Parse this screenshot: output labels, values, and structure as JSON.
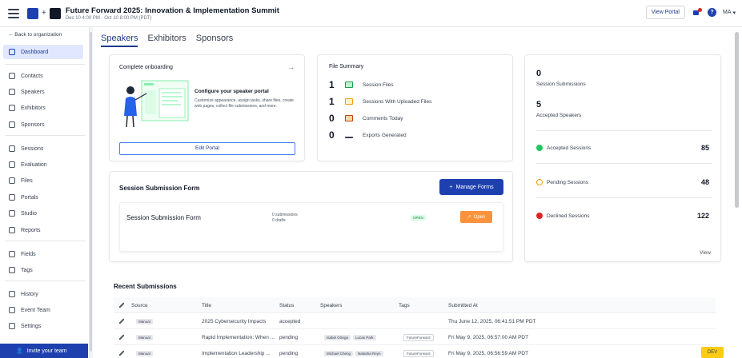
{
  "header": {
    "event_title": "Future Forward 2025: Innovation & Implementation Summit",
    "event_dates": "Dec 10 4:00 PM - Oct 10 8:00 PM (PDT)",
    "view_portal": "View Portal",
    "avatar_initials": "MA"
  },
  "sidebar": {
    "back_label": "← Back to organization",
    "items": [
      {
        "label": "Dashboard"
      },
      {
        "label": "Contacts"
      },
      {
        "label": "Speakers"
      },
      {
        "label": "Exhibitors"
      },
      {
        "label": "Sponsors"
      },
      {
        "label": "Sessions"
      },
      {
        "label": "Evaluation"
      },
      {
        "label": "Files"
      },
      {
        "label": "Portals"
      },
      {
        "label": "Studio"
      },
      {
        "label": "Reports"
      },
      {
        "label": "Fields"
      },
      {
        "label": "Tags"
      },
      {
        "label": "History"
      },
      {
        "label": "Event Team"
      },
      {
        "label": "Settings"
      }
    ],
    "invite_label": "Invite your team"
  },
  "tabs": [
    {
      "label": "Speakers"
    },
    {
      "label": "Exhibitors"
    },
    {
      "label": "Sponsors"
    }
  ],
  "onboarding": {
    "title": "Complete onboarding",
    "heading": "Configure your speaker portal",
    "description": "Customize appearance, assign tasks, share files, create web pages, collect file submissions, and more.",
    "button": "Edit Portal"
  },
  "file_summary": {
    "title": "File Summary",
    "rows": [
      {
        "value": "1",
        "label": "Session Files",
        "color": "#16a34a"
      },
      {
        "value": "1",
        "label": "Sessions With Uploaded Files",
        "color": "#f59e0b"
      },
      {
        "value": "0",
        "label": "Comments Today",
        "color": "#c2410c"
      },
      {
        "value": "0",
        "label": "Exports Generated",
        "color": "#374151"
      }
    ]
  },
  "stats": {
    "session_submissions_value": "0",
    "session_submissions_label": "Session Submissions",
    "accepted_speakers_value": "5",
    "accepted_speakers_label": "Accepted Speakers",
    "rows": [
      {
        "label": "Accepted Sessions",
        "value": "85",
        "color": "#22c55e"
      },
      {
        "label": "Pending Sessions",
        "value": "48",
        "color": "#f59e0b"
      },
      {
        "label": "Declined Sessions",
        "value": "122",
        "color": "#dc2626"
      }
    ],
    "view": "View"
  },
  "submission_form": {
    "title": "Session Submission Form",
    "manage_button": "Manage Forms",
    "form_name": "Session Submission Form",
    "submissions": "0 submissions",
    "drafts": "0 drafts",
    "status": "OPEN",
    "open_button": "Open"
  },
  "recent": {
    "title": "Recent Submissions",
    "columns": [
      "Source",
      "Title",
      "Status",
      "Speakers",
      "Tags",
      "Submitted At"
    ],
    "rows": [
      {
        "source": "Manual",
        "title": "2025 Cybersecurity Impacts",
        "status": "accepted",
        "speakers": [],
        "tags": [],
        "submitted": "Thu June 12, 2025, 06:41:51 PM PDT"
      },
      {
        "source": "Manual",
        "title": "Rapid Implementation: When ...",
        "status": "pending",
        "speakers": [
          "Isabel Ortega",
          "Lucas Park"
        ],
        "tags": [
          "FutureForward"
        ],
        "submitted": "Fri May 9, 2025, 06:57:00 AM PDT"
      },
      {
        "source": "Manual",
        "title": "Implementation Leadership ...",
        "status": "pending",
        "speakers": [
          "Michael Cheng",
          "Natasha Reyn"
        ],
        "tags": [
          "FutureForward"
        ],
        "submitted": "Fri May 9, 2025, 06:56:59 AM PDT"
      }
    ]
  },
  "dev_badge": "DEV"
}
